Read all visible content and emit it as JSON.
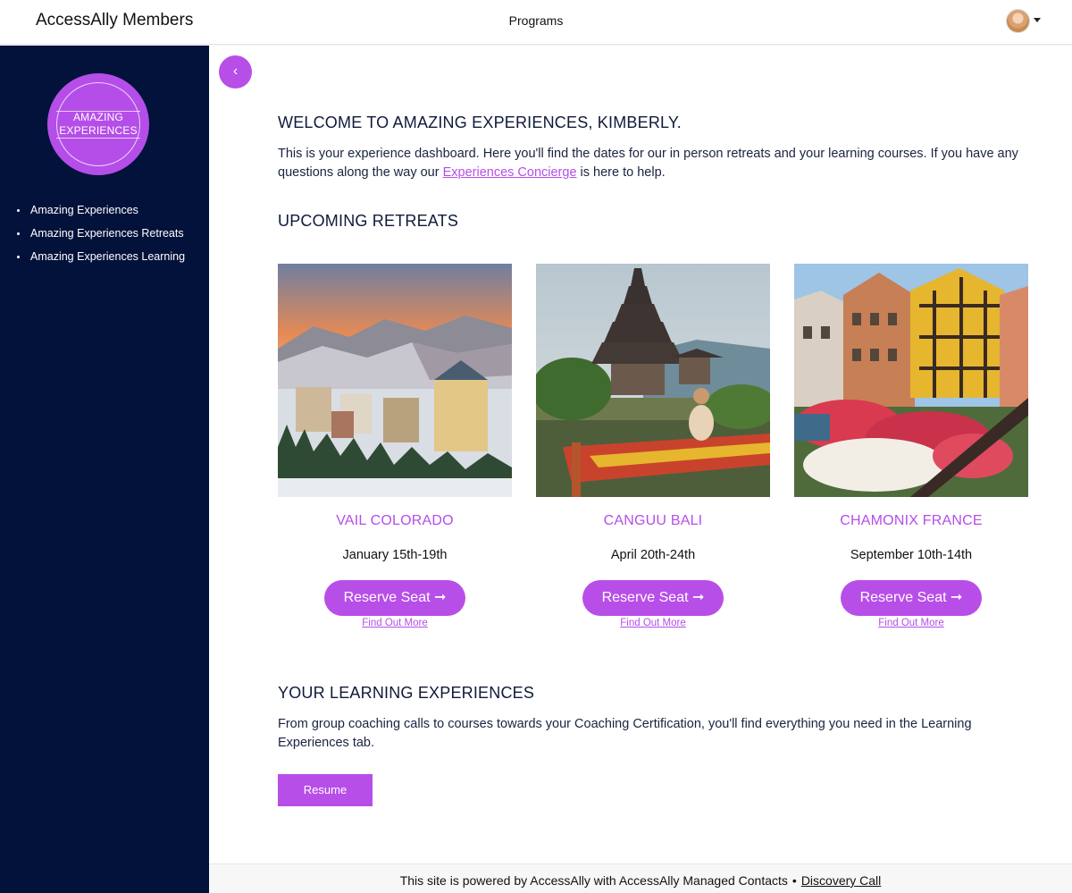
{
  "header": {
    "brand": "AccessAlly Members",
    "nav_label": "Programs",
    "avatar_icon": "user-avatar",
    "menu_icon": "caret-down-icon"
  },
  "sidebar": {
    "logo_line1": "AMAZING",
    "logo_line2": "EXPERIENCES",
    "items": [
      {
        "label": "Amazing Experiences"
      },
      {
        "label": "Amazing Experiences Retreats"
      },
      {
        "label": "Amazing Experiences Learning"
      }
    ]
  },
  "back_button": {
    "icon": "chevron-left-icon",
    "glyph": "‹"
  },
  "welcome": {
    "title": "WELCOME TO AMAZING EXPERIENCES, KIMBERLY.",
    "text_before": "This is your experience dashboard. Here you'll find the dates for our in person retreats and your learning courses. If you have any questions along the way our ",
    "link": "Experiences Concierge",
    "text_after": " is here to help."
  },
  "retreats": {
    "title": "UPCOMING RETREATS",
    "cards": [
      {
        "title": "VAIL COLORADO",
        "date": "January 15th-19th",
        "button": "Reserve Seat ➞",
        "link": "Find Out More"
      },
      {
        "title": "CANGUU BALI",
        "date": "April 20th-24th",
        "button": "Reserve Seat ➞",
        "link": "Find Out More"
      },
      {
        "title": "CHAMONIX FRANCE",
        "date": "September 10th-14th",
        "button": "Reserve Seat ➞",
        "link": "Find Out More"
      }
    ]
  },
  "learning": {
    "title": "YOUR LEARNING EXPERIENCES",
    "text": "From group coaching calls to courses towards your Coaching Certification, you'll find everything you need in the Learning Experiences tab.",
    "button": "Resume"
  },
  "footer": {
    "text": "This site is powered by AccessAlly with AccessAlly Managed Contacts",
    "separator": "•",
    "link": "Discovery Call"
  },
  "colors": {
    "accent": "#b84ee8",
    "sidebar_bg": "#03123b",
    "heading": "#0f1a3a"
  }
}
